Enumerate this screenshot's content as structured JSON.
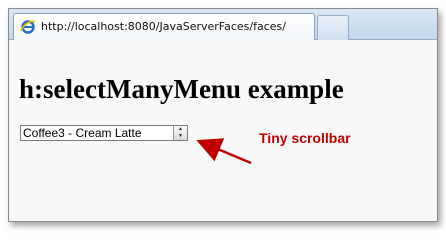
{
  "browser": {
    "tab_title": "http://localhost:8080/JavaServerFaces/faces/",
    "tab_icon": "ie-icon"
  },
  "page": {
    "heading": "h:selectManyMenu example",
    "listbox": {
      "value": "Coffee3 - Cream Latte"
    }
  },
  "annotation": {
    "label": "Tiny scrollbar",
    "color": "#c00000"
  }
}
